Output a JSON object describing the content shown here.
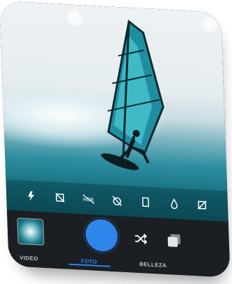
{
  "top_bar": {
    "left_icon": "expand-icon",
    "right_icon": "menu-icon"
  },
  "toolbar": {
    "icons": [
      "flash-auto-icon",
      "crop-off-icon",
      "hdr-off-icon",
      "timer-off-icon",
      "aspect-ratio-icon",
      "drop-icon",
      "grid-off-icon"
    ]
  },
  "controls": {
    "gallery_icon": "gallery-thumbnail",
    "shutter_color": "#2f86ea",
    "shuffle_icon": "shuffle-icon",
    "filters_icon": "filters-icon"
  },
  "modes": {
    "video": "VIDEO",
    "foto": "FOTO",
    "belleza": "BELLEZA",
    "active": "FOTO"
  },
  "colors": {
    "accent": "#2f86ea",
    "panel": "#1b1e22"
  }
}
